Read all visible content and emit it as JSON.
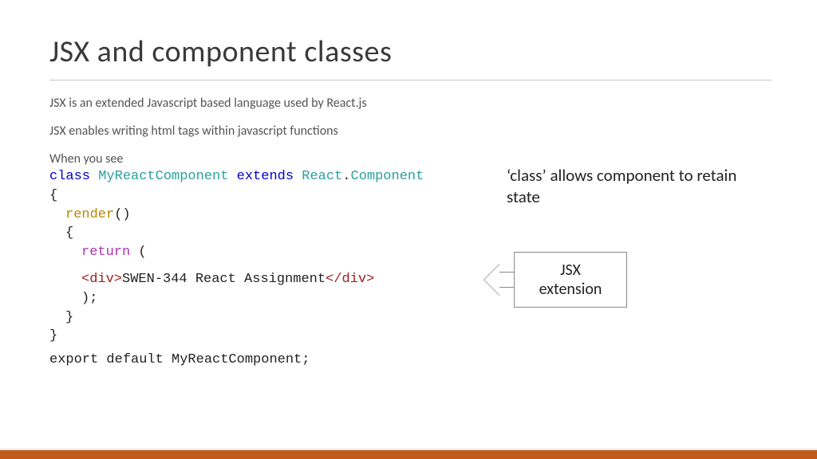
{
  "title": "JSX and component classes",
  "para1": "JSX is an extended Javascript based language used by React.js",
  "para2": "JSX enables writing html tags within javascript functions",
  "para3": "When you see",
  "code": {
    "kw_class": "class",
    "class_name": "MyReactComponent",
    "kw_extends": "extends",
    "react": "React",
    "dot": ".",
    "component": "Component",
    "brace_open": "{",
    "render_name": "render",
    "render_parens": "()",
    "brace_open2": "{",
    "kw_return": "return",
    "return_paren_open": " (",
    "div_open": "<div>",
    "div_text": "SWEN-344 React Assignment",
    "div_close": "</div>",
    "close_paren_semi": ");",
    "brace_close2": "}",
    "brace_close": "}"
  },
  "export_line": "export default MyReactComponent;",
  "annot1": "‘class’ allows component to retain state",
  "arrowbox_label_l1": "JSX",
  "arrowbox_label_l2": "extension"
}
